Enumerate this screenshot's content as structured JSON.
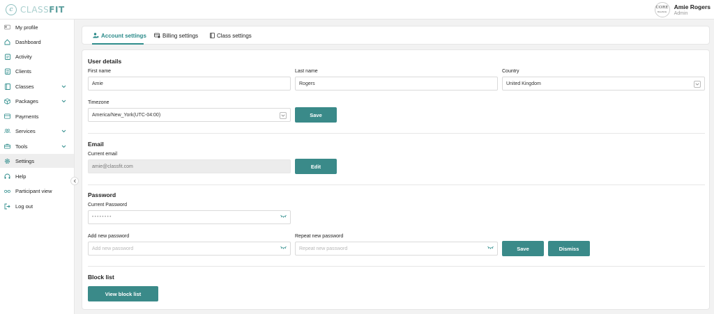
{
  "brand": {
    "logo_letter": "c",
    "name_light": "CLASS",
    "name_bold": "FIT"
  },
  "user": {
    "name": "Amie Rogers",
    "role": "Admin",
    "avatar_line1": "CORE",
    "avatar_line2": "BALANCE"
  },
  "sidebar": {
    "items": [
      {
        "label": "My profile",
        "icon": "profile-card-icon"
      },
      {
        "label": "Dashboard",
        "icon": "home-icon"
      },
      {
        "label": "Activity",
        "icon": "clipboard-icon"
      },
      {
        "label": "Clients",
        "icon": "clipboard-list-icon"
      },
      {
        "label": "Classes",
        "icon": "book-icon",
        "expandable": true
      },
      {
        "label": "Packages",
        "icon": "package-icon",
        "expandable": true
      },
      {
        "label": "Payments",
        "icon": "card-icon"
      },
      {
        "label": "Services",
        "icon": "people-icon",
        "expandable": true
      },
      {
        "label": "Tools",
        "icon": "toolbox-icon",
        "expandable": true
      },
      {
        "label": "Settings",
        "icon": "gear-icon",
        "active": true
      },
      {
        "label": "Help",
        "icon": "headset-icon"
      },
      {
        "label": "Participant view",
        "icon": "glasses-icon"
      },
      {
        "label": "Log out",
        "icon": "logout-icon"
      }
    ]
  },
  "tabs": {
    "account": "Account settings",
    "billing": "Billing settings",
    "class": "Class settings"
  },
  "user_details": {
    "title": "User details",
    "first_name_label": "First name",
    "first_name": "Amie",
    "last_name_label": "Last name",
    "last_name": "Rogers",
    "country_label": "Country",
    "country": "United Kingdom",
    "timezone_label": "Timezone",
    "timezone": "America/New_York(UTC-04:00)",
    "save_label": "Save"
  },
  "email": {
    "title": "Email",
    "current_label": "Current email",
    "current_value": "amie@classfit.com",
    "edit_label": "Edit"
  },
  "password": {
    "title": "Password",
    "current_label": "Current Password",
    "current_mask": "••••••••",
    "new_label": "Add new password",
    "new_placeholder": "Add new password",
    "repeat_label": "Repeat new password",
    "repeat_placeholder": "Repeat new password",
    "save_label": "Save",
    "dismiss_label": "Dismiss"
  },
  "block_list": {
    "title": "Block list",
    "button_label": "View block list"
  },
  "colors": {
    "accent": "#3a8a89",
    "accent_text": "#2a8a89",
    "logo_light": "#a9cfce"
  }
}
